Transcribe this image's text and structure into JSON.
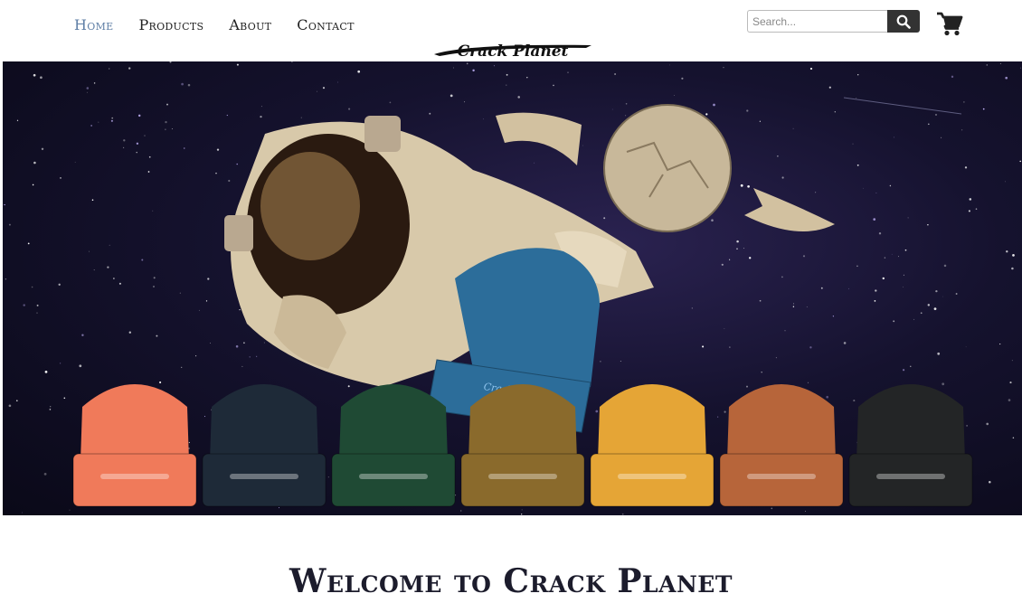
{
  "nav": {
    "items": [
      {
        "label": "Home",
        "active": true
      },
      {
        "label": "Products",
        "active": false
      },
      {
        "label": "About",
        "active": false
      },
      {
        "label": "Contact",
        "active": false
      }
    ]
  },
  "search": {
    "placeholder": "Search...",
    "value": ""
  },
  "logo": {
    "text": "Crack Planet"
  },
  "hero": {
    "description": "astronaut-holding-beanie-space-banner",
    "beanie_colors": [
      "#f07a5a",
      "#1e2a38",
      "#1f4a34",
      "#8a6a2c",
      "#e5a536",
      "#b7653a",
      "#232526"
    ],
    "featured_beanie_color": "#2c6d9a"
  },
  "welcome": {
    "title": "Welcome to Crack Planet"
  },
  "colors": {
    "accent": "#5f7fa6",
    "text": "#222222",
    "button": "#333333"
  }
}
